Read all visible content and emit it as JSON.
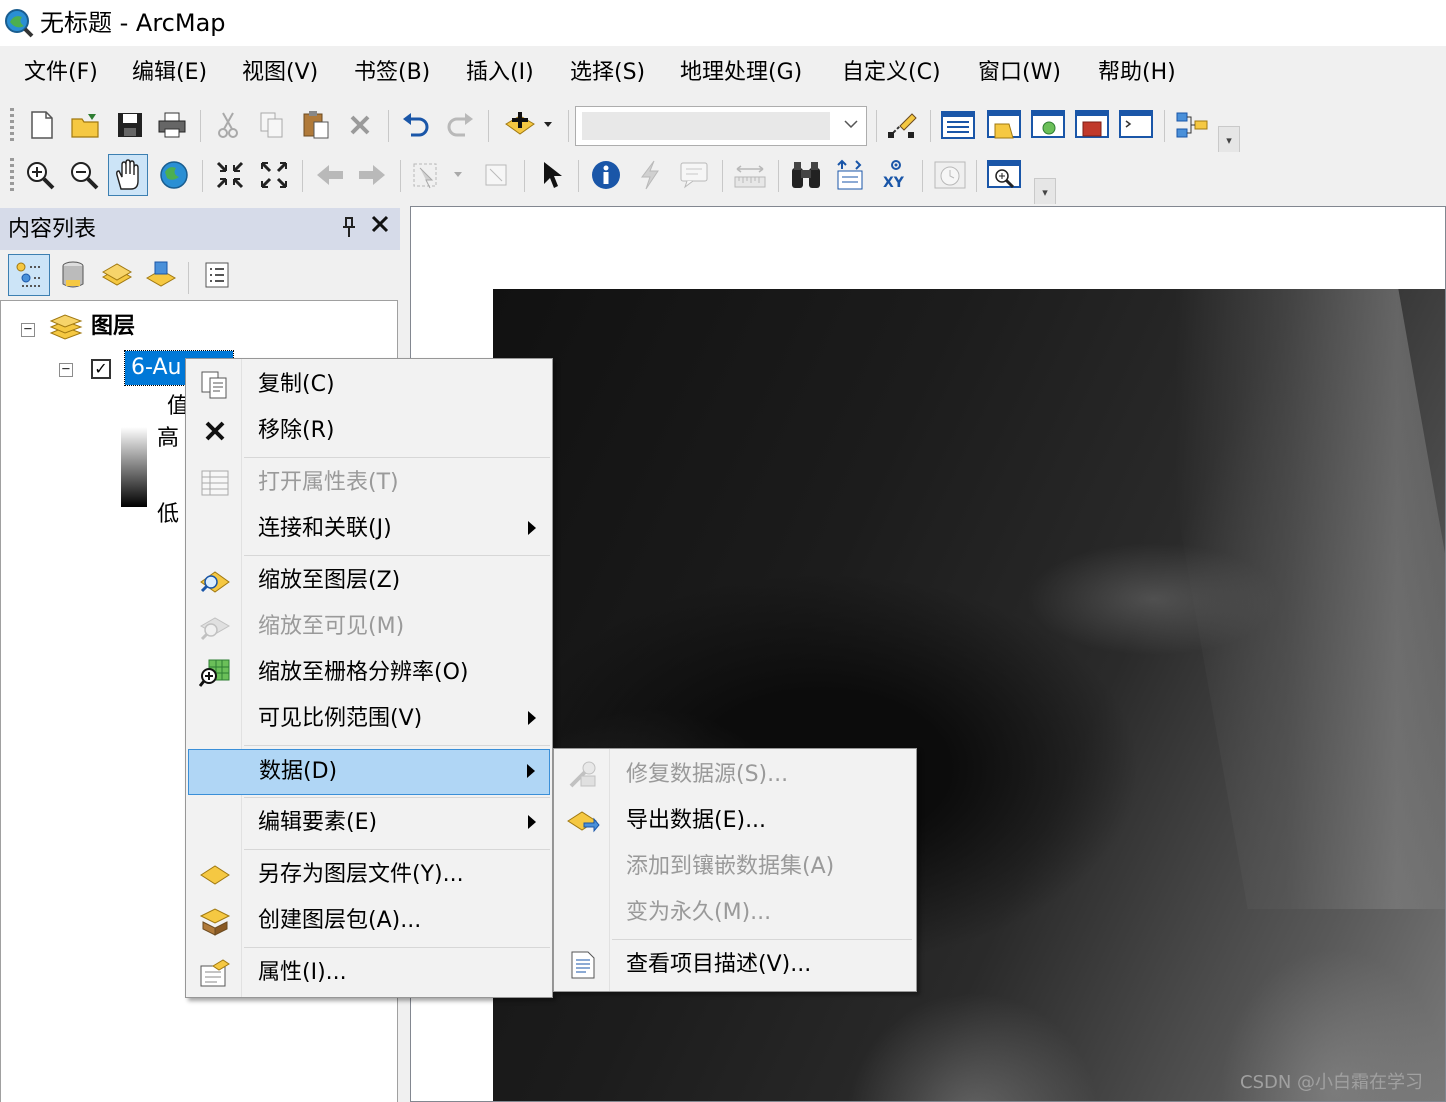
{
  "window": {
    "title": "无标题 - ArcMap"
  },
  "menubar": [
    "文件(F)",
    "编辑(E)",
    "视图(V)",
    "书签(B)",
    "插入(I)",
    "选择(S)",
    "地理处理(G)",
    "自定义(C)",
    "窗口(W)",
    "帮助(H)"
  ],
  "toolbar": {
    "scale_value": ""
  },
  "toc": {
    "title": "内容列表",
    "root_label": "图层",
    "layer_name": "6-Au",
    "legend_value_label": "值",
    "legend_high": "高",
    "legend_low": "低"
  },
  "context_menu": {
    "items": [
      {
        "label": "复制(C)",
        "icon": "copy-icon",
        "enabled": true
      },
      {
        "label": "移除(R)",
        "icon": "remove-icon",
        "enabled": true
      },
      {
        "label": "打开属性表(T)",
        "icon": "table-icon",
        "enabled": false
      },
      {
        "label": "连接和关联(J)",
        "enabled": true,
        "submenu": true
      },
      {
        "label": "缩放至图层(Z)",
        "icon": "zoom-to-layer-icon",
        "enabled": true
      },
      {
        "label": "缩放至可见(M)",
        "icon": "zoom-to-visible-icon",
        "enabled": false
      },
      {
        "label": "缩放至栅格分辨率(O)",
        "icon": "zoom-raster-resolution-icon",
        "enabled": true
      },
      {
        "label": "可见比例范围(V)",
        "enabled": true,
        "submenu": true
      },
      {
        "label": "数据(D)",
        "enabled": true,
        "submenu": true,
        "highlighted": true
      },
      {
        "label": "编辑要素(E)",
        "enabled": true,
        "submenu": true
      },
      {
        "label": "另存为图层文件(Y)...",
        "icon": "layer-file-icon",
        "enabled": true
      },
      {
        "label": "创建图层包(A)...",
        "icon": "layer-package-icon",
        "enabled": true
      },
      {
        "label": "属性(I)...",
        "icon": "properties-icon",
        "enabled": true
      }
    ]
  },
  "data_submenu": {
    "items": [
      {
        "label": "修复数据源(S)...",
        "icon": "repair-data-source-icon",
        "enabled": false
      },
      {
        "label": "导出数据(E)...",
        "icon": "export-data-icon",
        "enabled": true
      },
      {
        "label": "添加到镶嵌数据集(A)",
        "enabled": false
      },
      {
        "label": "变为永久(M)...",
        "enabled": false
      },
      {
        "label": "查看项目描述(V)...",
        "icon": "item-description-icon",
        "enabled": true
      }
    ]
  },
  "watermark": "CSDN @小白霜在学习",
  "colors": {
    "accent": "#0078d7",
    "menu_highlight": "#b0d6f5",
    "toc_header": "#d6dbe9"
  }
}
